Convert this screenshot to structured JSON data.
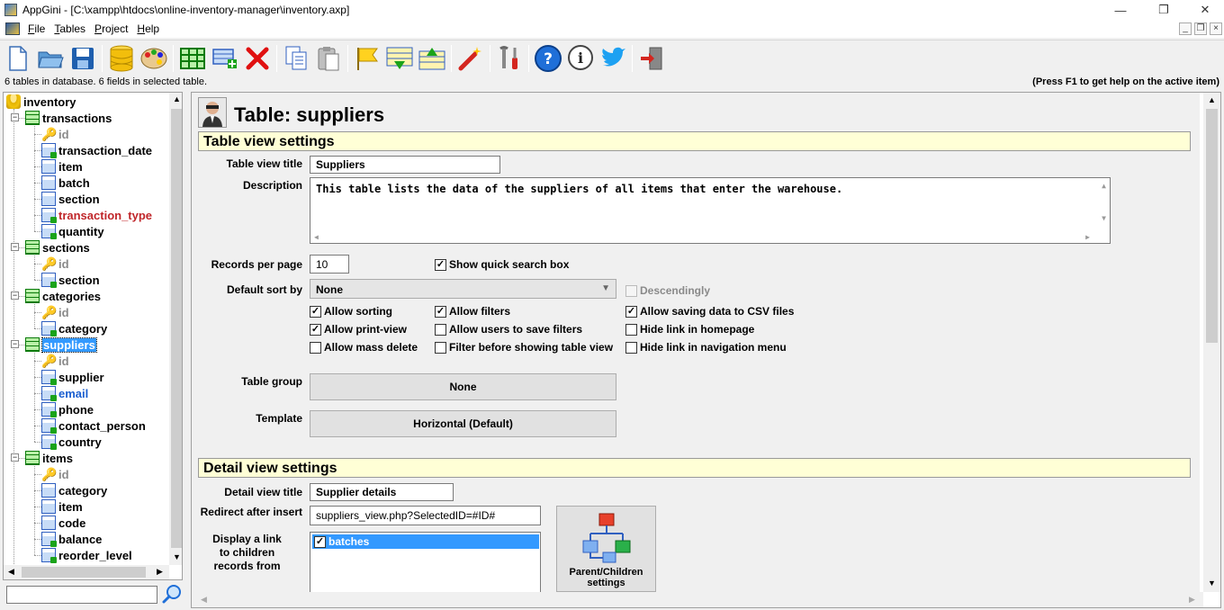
{
  "window": {
    "app_title": "AppGini - [C:\\xampp\\htdocs\\online-inventory-manager\\inventory.axp]",
    "minimize": "—",
    "maximize": "❐",
    "close": "✕"
  },
  "menu": {
    "items": [
      "File",
      "Tables",
      "Project",
      "Help"
    ]
  },
  "toolbar": {
    "buttons": [
      "new-file",
      "open-folder",
      "save",
      "database",
      "themes",
      "add-table",
      "add-field",
      "delete",
      "copy",
      "paste",
      "flag",
      "move-down",
      "move-up",
      "magic-wand",
      "tools",
      "help",
      "info",
      "twitter",
      "exit"
    ]
  },
  "status": {
    "left": "6 tables in database. 6 fields in selected table.",
    "right": "(Press F1 to get help on the active item)"
  },
  "tree": {
    "root": "inventory",
    "tables": [
      {
        "name": "transactions",
        "fields": [
          "id",
          "transaction_date",
          "item",
          "batch",
          "section",
          "transaction_type",
          "quantity"
        ]
      },
      {
        "name": "sections",
        "fields": [
          "id",
          "section"
        ]
      },
      {
        "name": "categories",
        "fields": [
          "id",
          "category"
        ]
      },
      {
        "name": "suppliers",
        "fields": [
          "id",
          "supplier",
          "email",
          "phone",
          "contact_person",
          "country"
        ]
      },
      {
        "name": "items",
        "fields": [
          "id",
          "category",
          "item",
          "code",
          "balance",
          "reorder_level"
        ]
      }
    ]
  },
  "search": {
    "value": ""
  },
  "table": {
    "heading": "Table: suppliers",
    "table_view_section": "Table view settings",
    "table_view_title_label": "Table view title",
    "table_view_title": "Suppliers",
    "description_label": "Description",
    "description": "This table lists the data of the suppliers of all items that enter the warehouse.",
    "records_per_page_label": "Records per page",
    "records_per_page": "10",
    "show_quick_search": "Show quick search box",
    "default_sort_label": "Default sort by",
    "default_sort": "None",
    "descendingly": "Descendingly",
    "allow_sorting": "Allow sorting",
    "allow_filters": "Allow filters",
    "allow_csv": "Allow saving data to CSV files",
    "allow_print": "Allow print-view",
    "allow_save_filters": "Allow users to save filters",
    "hide_homepage": "Hide link in homepage",
    "allow_mass_delete": "Allow mass delete",
    "filter_before": "Filter before showing table view",
    "hide_nav": "Hide link in navigation menu",
    "table_group_label": "Table group",
    "table_group": "None",
    "template_label": "Template",
    "template": "Horizontal (Default)",
    "detail_view_section": "Detail view settings",
    "detail_view_title_label": "Detail view title",
    "detail_view_title": "Supplier details",
    "redirect_label": "Redirect after insert",
    "redirect": "suppliers_view.php?SelectedID=#ID#",
    "display_link_label_1": "Display a link",
    "display_link_label_2": "to children",
    "display_link_label_3": "records from",
    "children": [
      "batches"
    ],
    "parent_children_1": "Parent/Children",
    "parent_children_2": "settings"
  },
  "checkbox_glyph": "✓"
}
